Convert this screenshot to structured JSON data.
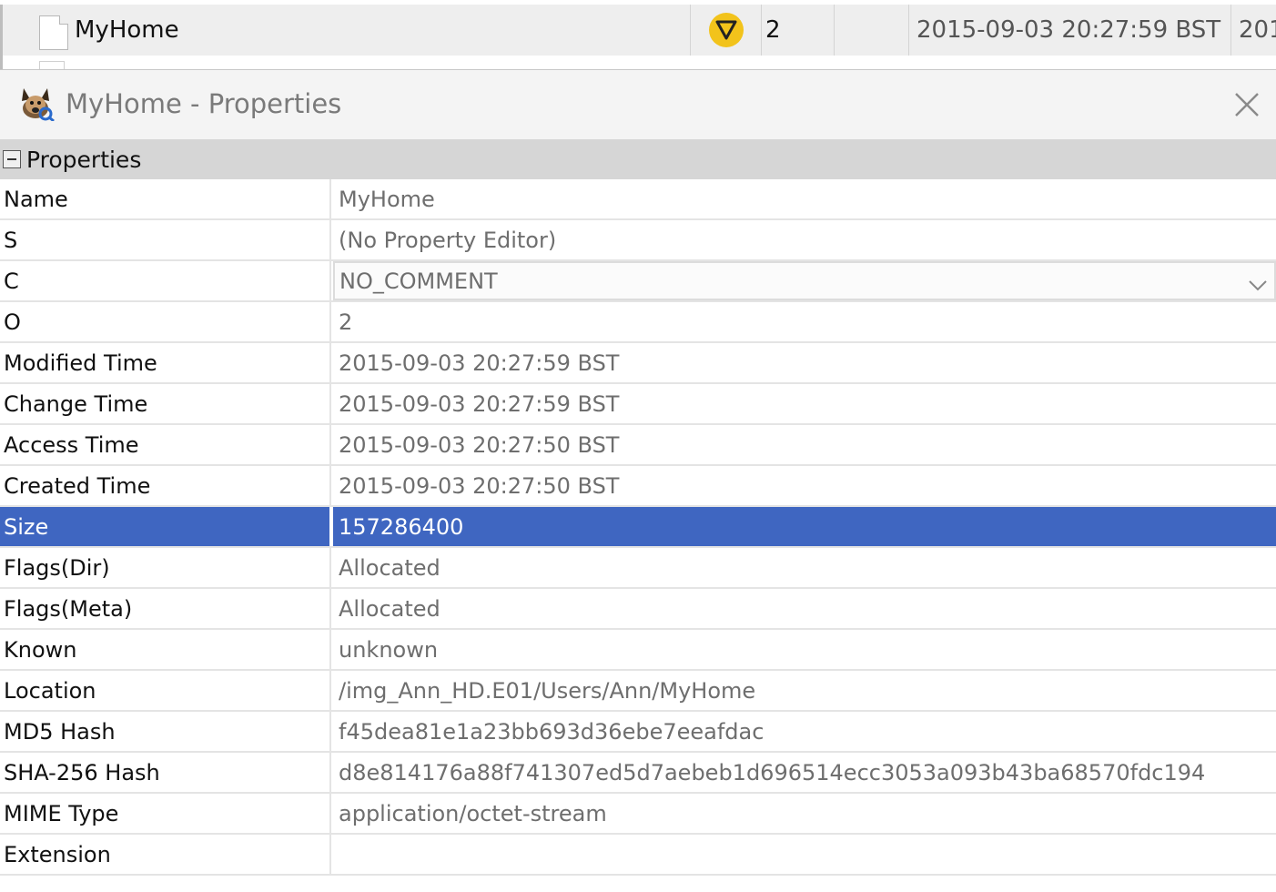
{
  "background_table": {
    "row": {
      "name": "MyHome",
      "icon": "file-icon",
      "status_icon": "warning-triangle-icon",
      "count": "2",
      "modified": "2015-09-03 20:27:59 BST",
      "next_col_partial": "201"
    }
  },
  "window": {
    "title": "MyHome - Properties",
    "app_icon": "autopsy-dog-icon",
    "close_icon": "close-icon"
  },
  "section": {
    "title": "Properties",
    "collapse_icon": "collapse-minus-icon"
  },
  "properties": [
    {
      "key": "Name",
      "value": "MyHome"
    },
    {
      "key": "S",
      "value": "(No Property Editor)"
    },
    {
      "key": "C",
      "value": "NO_COMMENT"
    },
    {
      "key": "O",
      "value": "2"
    },
    {
      "key": "Modified Time",
      "value": "2015-09-03 20:27:59 BST"
    },
    {
      "key": "Change Time",
      "value": "2015-09-03 20:27:59 BST"
    },
    {
      "key": "Access Time",
      "value": "2015-09-03 20:27:50 BST"
    },
    {
      "key": "Created Time",
      "value": "2015-09-03 20:27:50 BST"
    },
    {
      "key": "Size",
      "value": "157286400"
    },
    {
      "key": "Flags(Dir)",
      "value": "Allocated"
    },
    {
      "key": "Flags(Meta)",
      "value": "Allocated"
    },
    {
      "key": "Known",
      "value": "unknown"
    },
    {
      "key": "Location",
      "value": "/img_Ann_HD.E01/Users/Ann/MyHome"
    },
    {
      "key": "MD5 Hash",
      "value": "f45dea81e1a23bb693d36ebe7eeafdac"
    },
    {
      "key": "SHA-256 Hash",
      "value": "d8e814176a88f741307ed5d7aebeb1d696514ecc3053a093b43ba68570fdc194"
    },
    {
      "key": "MIME Type",
      "value": "application/octet-stream"
    },
    {
      "key": "Extension",
      "value": ""
    }
  ],
  "selected_property": "Size",
  "colors": {
    "selection": "#3f66c1",
    "warning": "#f2c31b"
  }
}
